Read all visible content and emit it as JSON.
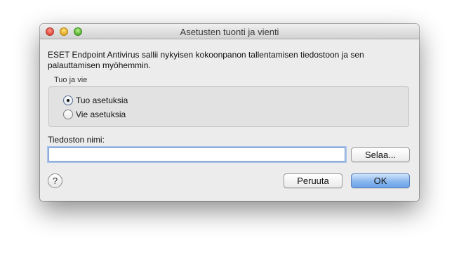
{
  "window": {
    "title": "Asetusten tuonti ja vienti"
  },
  "description": "ESET Endpoint Antivirus sallii nykyisen kokoonpanon tallentamisen tiedostoon ja sen palauttamisen myöhemmin.",
  "group": {
    "label": "Tuo ja vie",
    "options": [
      {
        "label": "Tuo asetuksia",
        "selected": true
      },
      {
        "label": "Vie asetuksia",
        "selected": false
      }
    ]
  },
  "file": {
    "label": "Tiedoston nimi:",
    "value": "",
    "browse_label": "Selaa..."
  },
  "buttons": {
    "help_label": "?",
    "cancel_label": "Peruuta",
    "ok_label": "OK"
  },
  "colors": {
    "ok_button": "#6aa2e8",
    "focus_ring": "#a8c4ea"
  }
}
